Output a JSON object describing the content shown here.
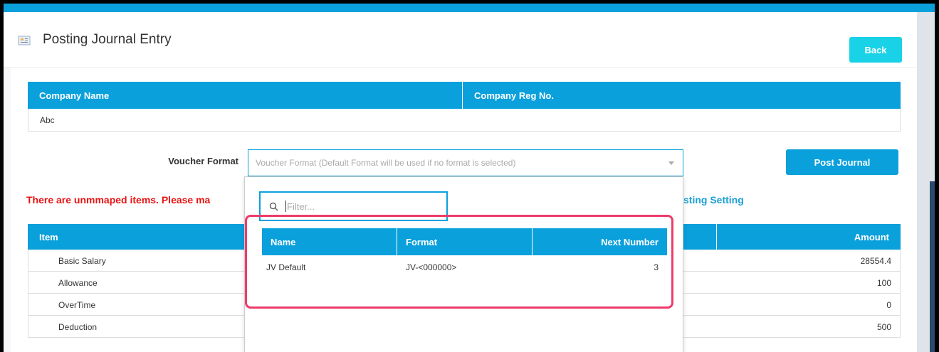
{
  "header": {
    "title": "Posting Journal Entry",
    "back_label": "Back"
  },
  "company_table": {
    "columns": [
      "Company Name",
      "Company Reg No."
    ],
    "rows": [
      [
        "Abc",
        ""
      ]
    ]
  },
  "voucher": {
    "label": "Voucher Format",
    "placeholder": "Voucher Format (Default Format will be used if no format is selected)",
    "post_label": "Post Journal"
  },
  "warning": {
    "text": "There are unmmaped items. Please ma",
    "link_text": "sting Setting"
  },
  "items_table": {
    "columns": [
      "Item",
      "Amount"
    ],
    "rows": [
      {
        "item": "Basic Salary",
        "amount": "28554.4"
      },
      {
        "item": "Allowance",
        "amount": "100"
      },
      {
        "item": "OverTime",
        "amount": "0"
      },
      {
        "item": "Deduction",
        "amount": "500"
      }
    ]
  },
  "dropdown": {
    "filter_placeholder": "Filter...",
    "columns": [
      "Name",
      "Format",
      "Next Number"
    ],
    "rows": [
      {
        "name": "JV Default",
        "format": "JV-<000000>",
        "next": "3"
      }
    ]
  },
  "colors": {
    "primary": "#0aa0dc",
    "accent": "#19d2e8",
    "warning": "#e81414",
    "highlight": "#ee3b6a"
  }
}
